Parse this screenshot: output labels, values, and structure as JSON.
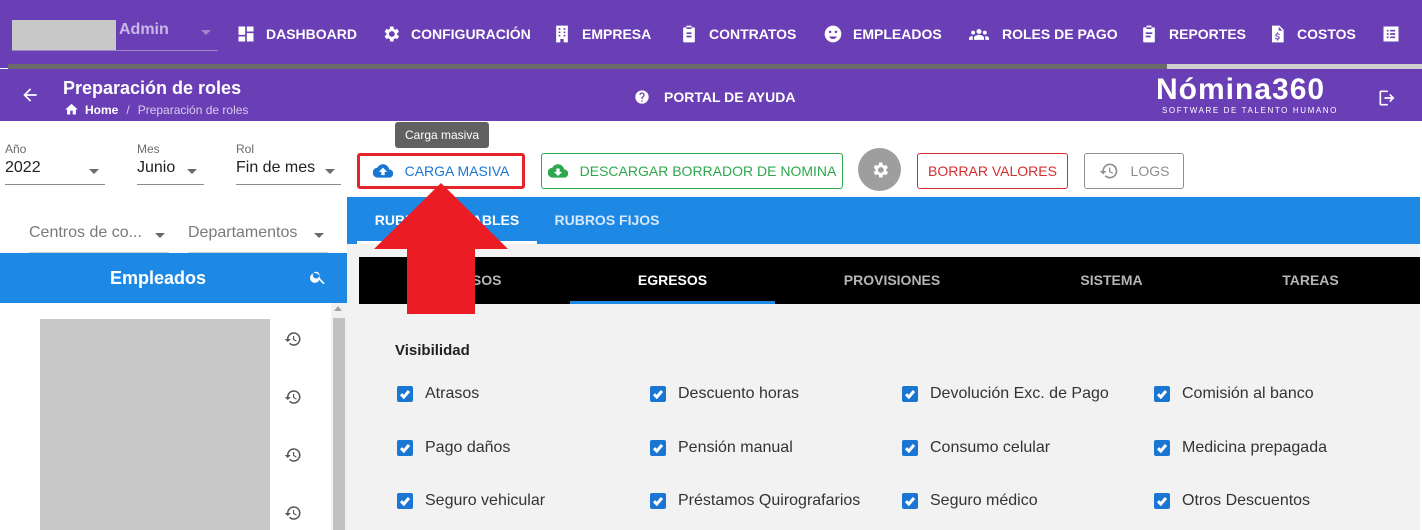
{
  "topnav": {
    "user_name": "Admin",
    "items": [
      {
        "label": "DASHBOARD",
        "icon": "dashboard-icon"
      },
      {
        "label": "CONFIGURACIÓN",
        "icon": "gear-icon"
      },
      {
        "label": "EMPRESA",
        "icon": "building-icon"
      },
      {
        "label": "CONTRATOS",
        "icon": "clipboard-icon"
      },
      {
        "label": "EMPLEADOS",
        "icon": "face-icon"
      },
      {
        "label": "ROLES DE PAGO",
        "icon": "group-icon"
      },
      {
        "label": "REPORTES",
        "icon": "assignment-icon"
      },
      {
        "label": "COSTOS",
        "icon": "dollar-file-icon"
      }
    ],
    "progress_fraction": 0.82
  },
  "header": {
    "title": "Preparación de roles",
    "breadcrumb_home": "Home",
    "breadcrumb_sep": "/",
    "breadcrumb_current": "Preparación de roles",
    "help_label": "PORTAL DE AYUDA",
    "logo_main": "Nómina360",
    "logo_sub": "SOFTWARE DE TALENTO HUMANO"
  },
  "tooltip": "Carga masiva",
  "filters": {
    "anio": {
      "label": "Año",
      "value": "2022"
    },
    "mes": {
      "label": "Mes",
      "value": "Junio"
    },
    "rol": {
      "label": "Rol",
      "value": "Fin de mes"
    },
    "centros": "Centros de co...",
    "departamentos": "Departamentos"
  },
  "toolbar": {
    "carga": "CARGA MASIVA",
    "descargar": "DESCARGAR BORRADOR DE NOMINA",
    "borrar": "BORRAR VALORES",
    "logs": "LOGS"
  },
  "employees": {
    "title": "Empleados"
  },
  "tabs": {
    "variables": "RUBROS VARIABLES",
    "fijos": "RUBROS FIJOS"
  },
  "subtabs": [
    "INGRESOS",
    "EGRESOS",
    "PROVISIONES",
    "SISTEMA",
    "TAREAS"
  ],
  "visibility": {
    "title": "Visibilidad",
    "items": [
      "Atrasos",
      "Descuento horas",
      "Devolución Exc. de Pago",
      "Comisión al banco",
      "Pago daños",
      "Pensión manual",
      "Consumo celular",
      "Medicina prepagada",
      "Seguro vehicular",
      "Préstamos Quirografarios",
      "Seguro médico",
      "Otros Descuentos"
    ]
  },
  "colors": {
    "nav": "#6a3fb5",
    "primary": "#1e88e5",
    "danger": "#d32f2f",
    "success": "#2ea84c",
    "highlight": "#e5252a"
  }
}
